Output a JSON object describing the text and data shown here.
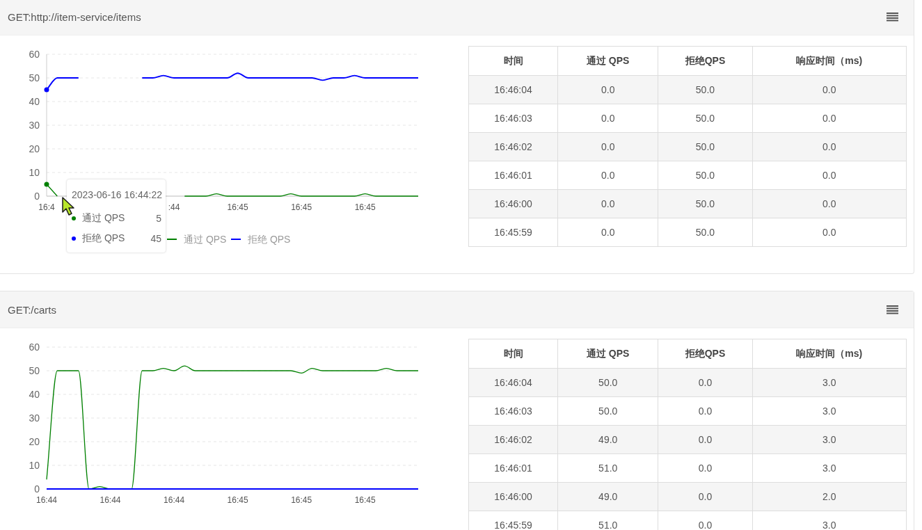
{
  "panels": [
    {
      "title": "GET:http://item-service/items",
      "chart_data": {
        "type": "line",
        "yticks": [
          0,
          10,
          20,
          30,
          40,
          50,
          60
        ],
        "ylim": [
          0,
          60
        ],
        "grid": true,
        "legend": true,
        "categories": [
          "16:4",
          null,
          null,
          null,
          null,
          null,
          null,
          null,
          null,
          null,
          null,
          null,
          ":44",
          null,
          null,
          null,
          null,
          null,
          "16:45",
          null,
          null,
          null,
          null,
          null,
          "16:45",
          null,
          null,
          null,
          null,
          null,
          "16:45",
          null,
          null,
          null,
          null,
          null
        ],
        "series": [
          {
            "name": "通过 QPS",
            "color": "#008000",
            "values": [
              5,
              0,
              null,
              null,
              null,
              null,
              null,
              null,
              null,
              null,
              null,
              null,
              null,
              0,
              0,
              0,
              1,
              0,
              0,
              0,
              0,
              0,
              0,
              1,
              0,
              0,
              0,
              0,
              0,
              0,
              1,
              0,
              0,
              0,
              0,
              0
            ]
          },
          {
            "name": "拒绝 QPS",
            "color": "#0000ff",
            "values": [
              45,
              50,
              50,
              50,
              null,
              null,
              null,
              null,
              null,
              50,
              50,
              51,
              50,
              50,
              50,
              50,
              50,
              50,
              52,
              50,
              50,
              50,
              50,
              50,
              50,
              50,
              49,
              50,
              50,
              51,
              50,
              50,
              50,
              50,
              50,
              50
            ]
          }
        ]
      },
      "tooltip": {
        "title": "2023-06-16 16:44:22",
        "rows": [
          {
            "name": "通过 QPS",
            "value": "5",
            "color": "#008000"
          },
          {
            "name": "拒绝 QPS",
            "value": "45",
            "color": "#0000ff"
          }
        ]
      },
      "table": {
        "columns": [
          "时间",
          "通过 QPS",
          "拒绝QPS",
          "响应时间（ms)"
        ],
        "rows": [
          [
            "16:46:04",
            "0.0",
            "50.0",
            "0.0"
          ],
          [
            "16:46:03",
            "0.0",
            "50.0",
            "0.0"
          ],
          [
            "16:46:02",
            "0.0",
            "50.0",
            "0.0"
          ],
          [
            "16:46:01",
            "0.0",
            "50.0",
            "0.0"
          ],
          [
            "16:46:00",
            "0.0",
            "50.0",
            "0.0"
          ],
          [
            "16:45:59",
            "0.0",
            "50.0",
            "0.0"
          ]
        ]
      }
    },
    {
      "title": "GET:/carts",
      "chart_data": {
        "type": "line",
        "yticks": [
          0,
          10,
          20,
          30,
          40,
          50,
          60
        ],
        "ylim": [
          0,
          60
        ],
        "grid": true,
        "categories": [
          "16:44",
          null,
          null,
          null,
          null,
          null,
          "16:44",
          null,
          null,
          null,
          null,
          null,
          "16:44",
          null,
          null,
          null,
          null,
          null,
          "16:45",
          null,
          null,
          null,
          null,
          null,
          "16:45",
          null,
          null,
          null,
          null,
          null,
          "16:45",
          null,
          null,
          null,
          null,
          null
        ],
        "series": [
          {
            "color": "#008000",
            "values": [
              4,
              50,
              50,
              50,
              0,
              1,
              0,
              0,
              0,
              50,
              50,
              51,
              50,
              52,
              50,
              50,
              50,
              50,
              50,
              50,
              50,
              50,
              50,
              50,
              49,
              51,
              50,
              50,
              50,
              50,
              50,
              50,
              51,
              50,
              50,
              50
            ]
          },
          {
            "color": "#0000ff",
            "values": [
              0,
              0,
              0,
              0,
              0,
              0,
              0,
              0,
              0,
              0,
              0,
              0,
              0,
              0,
              0,
              0,
              0,
              0,
              0,
              0,
              0,
              0,
              0,
              0,
              0,
              0,
              0,
              0,
              0,
              0,
              0,
              0,
              0,
              0,
              0,
              0
            ]
          }
        ]
      },
      "table": {
        "columns": [
          "时间",
          "通过 QPS",
          "拒绝QPS",
          "响应时间（ms)"
        ],
        "rows": [
          [
            "16:46:04",
            "50.0",
            "0.0",
            "3.0"
          ],
          [
            "16:46:03",
            "50.0",
            "0.0",
            "3.0"
          ],
          [
            "16:46:02",
            "49.0",
            "0.0",
            "3.0"
          ],
          [
            "16:46:01",
            "51.0",
            "0.0",
            "3.0"
          ],
          [
            "16:46:00",
            "49.0",
            "0.0",
            "2.0"
          ],
          [
            "16:45:59",
            "51.0",
            "0.0",
            "3.0"
          ]
        ]
      }
    }
  ]
}
